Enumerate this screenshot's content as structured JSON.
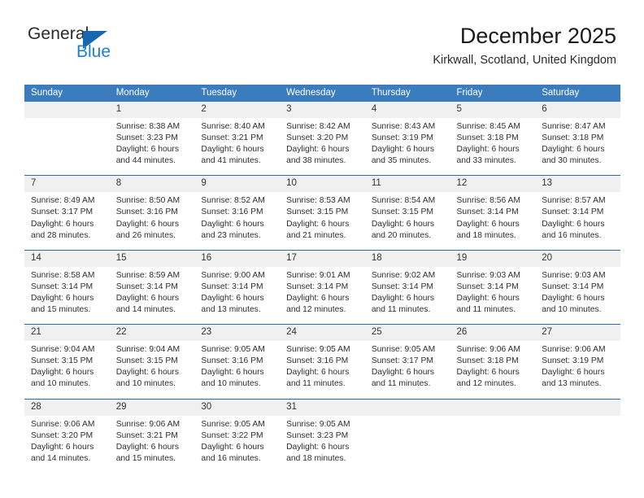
{
  "brand": {
    "name_part1": "General",
    "name_part2": "Blue",
    "triangle_color": "#1567b2",
    "blue_color": "#1b7fd4"
  },
  "header": {
    "title": "December 2025",
    "subtitle": "Kirkwall, Scotland, United Kingdom"
  },
  "theme": {
    "header_bg": "#3b7cbe",
    "header_text": "#ffffff",
    "row_divider": "#2e6da4",
    "daynum_bg": "#f0f0f0"
  },
  "calendar": {
    "weekday_headers": [
      "Sunday",
      "Monday",
      "Tuesday",
      "Wednesday",
      "Thursday",
      "Friday",
      "Saturday"
    ],
    "weeks": [
      [
        {
          "day": "",
          "sunrise": "",
          "sunset": "",
          "daylight1": "",
          "daylight2": ""
        },
        {
          "day": "1",
          "sunrise": "Sunrise: 8:38 AM",
          "sunset": "Sunset: 3:23 PM",
          "daylight1": "Daylight: 6 hours",
          "daylight2": "and 44 minutes."
        },
        {
          "day": "2",
          "sunrise": "Sunrise: 8:40 AM",
          "sunset": "Sunset: 3:21 PM",
          "daylight1": "Daylight: 6 hours",
          "daylight2": "and 41 minutes."
        },
        {
          "day": "3",
          "sunrise": "Sunrise: 8:42 AM",
          "sunset": "Sunset: 3:20 PM",
          "daylight1": "Daylight: 6 hours",
          "daylight2": "and 38 minutes."
        },
        {
          "day": "4",
          "sunrise": "Sunrise: 8:43 AM",
          "sunset": "Sunset: 3:19 PM",
          "daylight1": "Daylight: 6 hours",
          "daylight2": "and 35 minutes."
        },
        {
          "day": "5",
          "sunrise": "Sunrise: 8:45 AM",
          "sunset": "Sunset: 3:18 PM",
          "daylight1": "Daylight: 6 hours",
          "daylight2": "and 33 minutes."
        },
        {
          "day": "6",
          "sunrise": "Sunrise: 8:47 AM",
          "sunset": "Sunset: 3:18 PM",
          "daylight1": "Daylight: 6 hours",
          "daylight2": "and 30 minutes."
        }
      ],
      [
        {
          "day": "7",
          "sunrise": "Sunrise: 8:49 AM",
          "sunset": "Sunset: 3:17 PM",
          "daylight1": "Daylight: 6 hours",
          "daylight2": "and 28 minutes."
        },
        {
          "day": "8",
          "sunrise": "Sunrise: 8:50 AM",
          "sunset": "Sunset: 3:16 PM",
          "daylight1": "Daylight: 6 hours",
          "daylight2": "and 26 minutes."
        },
        {
          "day": "9",
          "sunrise": "Sunrise: 8:52 AM",
          "sunset": "Sunset: 3:16 PM",
          "daylight1": "Daylight: 6 hours",
          "daylight2": "and 23 minutes."
        },
        {
          "day": "10",
          "sunrise": "Sunrise: 8:53 AM",
          "sunset": "Sunset: 3:15 PM",
          "daylight1": "Daylight: 6 hours",
          "daylight2": "and 21 minutes."
        },
        {
          "day": "11",
          "sunrise": "Sunrise: 8:54 AM",
          "sunset": "Sunset: 3:15 PM",
          "daylight1": "Daylight: 6 hours",
          "daylight2": "and 20 minutes."
        },
        {
          "day": "12",
          "sunrise": "Sunrise: 8:56 AM",
          "sunset": "Sunset: 3:14 PM",
          "daylight1": "Daylight: 6 hours",
          "daylight2": "and 18 minutes."
        },
        {
          "day": "13",
          "sunrise": "Sunrise: 8:57 AM",
          "sunset": "Sunset: 3:14 PM",
          "daylight1": "Daylight: 6 hours",
          "daylight2": "and 16 minutes."
        }
      ],
      [
        {
          "day": "14",
          "sunrise": "Sunrise: 8:58 AM",
          "sunset": "Sunset: 3:14 PM",
          "daylight1": "Daylight: 6 hours",
          "daylight2": "and 15 minutes."
        },
        {
          "day": "15",
          "sunrise": "Sunrise: 8:59 AM",
          "sunset": "Sunset: 3:14 PM",
          "daylight1": "Daylight: 6 hours",
          "daylight2": "and 14 minutes."
        },
        {
          "day": "16",
          "sunrise": "Sunrise: 9:00 AM",
          "sunset": "Sunset: 3:14 PM",
          "daylight1": "Daylight: 6 hours",
          "daylight2": "and 13 minutes."
        },
        {
          "day": "17",
          "sunrise": "Sunrise: 9:01 AM",
          "sunset": "Sunset: 3:14 PM",
          "daylight1": "Daylight: 6 hours",
          "daylight2": "and 12 minutes."
        },
        {
          "day": "18",
          "sunrise": "Sunrise: 9:02 AM",
          "sunset": "Sunset: 3:14 PM",
          "daylight1": "Daylight: 6 hours",
          "daylight2": "and 11 minutes."
        },
        {
          "day": "19",
          "sunrise": "Sunrise: 9:03 AM",
          "sunset": "Sunset: 3:14 PM",
          "daylight1": "Daylight: 6 hours",
          "daylight2": "and 11 minutes."
        },
        {
          "day": "20",
          "sunrise": "Sunrise: 9:03 AM",
          "sunset": "Sunset: 3:14 PM",
          "daylight1": "Daylight: 6 hours",
          "daylight2": "and 10 minutes."
        }
      ],
      [
        {
          "day": "21",
          "sunrise": "Sunrise: 9:04 AM",
          "sunset": "Sunset: 3:15 PM",
          "daylight1": "Daylight: 6 hours",
          "daylight2": "and 10 minutes."
        },
        {
          "day": "22",
          "sunrise": "Sunrise: 9:04 AM",
          "sunset": "Sunset: 3:15 PM",
          "daylight1": "Daylight: 6 hours",
          "daylight2": "and 10 minutes."
        },
        {
          "day": "23",
          "sunrise": "Sunrise: 9:05 AM",
          "sunset": "Sunset: 3:16 PM",
          "daylight1": "Daylight: 6 hours",
          "daylight2": "and 10 minutes."
        },
        {
          "day": "24",
          "sunrise": "Sunrise: 9:05 AM",
          "sunset": "Sunset: 3:16 PM",
          "daylight1": "Daylight: 6 hours",
          "daylight2": "and 11 minutes."
        },
        {
          "day": "25",
          "sunrise": "Sunrise: 9:05 AM",
          "sunset": "Sunset: 3:17 PM",
          "daylight1": "Daylight: 6 hours",
          "daylight2": "and 11 minutes."
        },
        {
          "day": "26",
          "sunrise": "Sunrise: 9:06 AM",
          "sunset": "Sunset: 3:18 PM",
          "daylight1": "Daylight: 6 hours",
          "daylight2": "and 12 minutes."
        },
        {
          "day": "27",
          "sunrise": "Sunrise: 9:06 AM",
          "sunset": "Sunset: 3:19 PM",
          "daylight1": "Daylight: 6 hours",
          "daylight2": "and 13 minutes."
        }
      ],
      [
        {
          "day": "28",
          "sunrise": "Sunrise: 9:06 AM",
          "sunset": "Sunset: 3:20 PM",
          "daylight1": "Daylight: 6 hours",
          "daylight2": "and 14 minutes."
        },
        {
          "day": "29",
          "sunrise": "Sunrise: 9:06 AM",
          "sunset": "Sunset: 3:21 PM",
          "daylight1": "Daylight: 6 hours",
          "daylight2": "and 15 minutes."
        },
        {
          "day": "30",
          "sunrise": "Sunrise: 9:05 AM",
          "sunset": "Sunset: 3:22 PM",
          "daylight1": "Daylight: 6 hours",
          "daylight2": "and 16 minutes."
        },
        {
          "day": "31",
          "sunrise": "Sunrise: 9:05 AM",
          "sunset": "Sunset: 3:23 PM",
          "daylight1": "Daylight: 6 hours",
          "daylight2": "and 18 minutes."
        },
        {
          "day": "",
          "sunrise": "",
          "sunset": "",
          "daylight1": "",
          "daylight2": ""
        },
        {
          "day": "",
          "sunrise": "",
          "sunset": "",
          "daylight1": "",
          "daylight2": ""
        },
        {
          "day": "",
          "sunrise": "",
          "sunset": "",
          "daylight1": "",
          "daylight2": ""
        }
      ]
    ]
  }
}
